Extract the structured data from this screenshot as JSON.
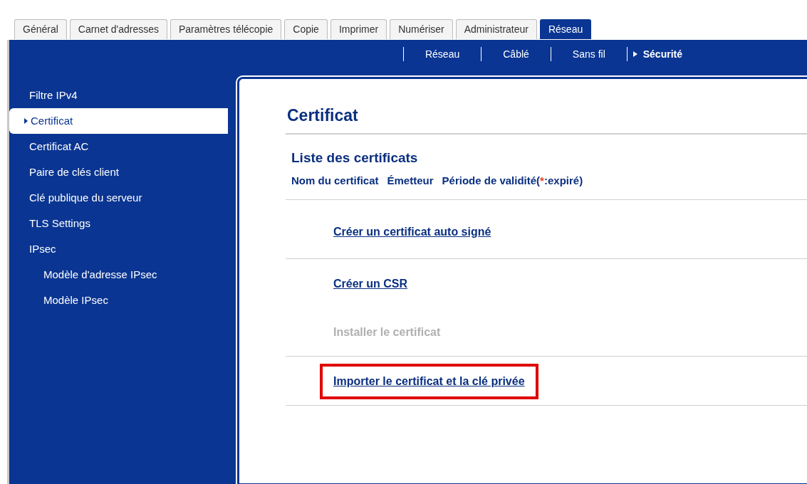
{
  "tabs": [
    {
      "label": "Général",
      "selected": false
    },
    {
      "label": "Carnet d'adresses",
      "selected": false
    },
    {
      "label": "Paramètres télécopie",
      "selected": false
    },
    {
      "label": "Copie",
      "selected": false
    },
    {
      "label": "Imprimer",
      "selected": false
    },
    {
      "label": "Numériser",
      "selected": false
    },
    {
      "label": "Administrateur",
      "selected": false
    },
    {
      "label": "Réseau",
      "selected": true
    }
  ],
  "subnav": [
    {
      "label": "Réseau",
      "selected": false
    },
    {
      "label": "Câblé",
      "selected": false
    },
    {
      "label": "Sans fil",
      "selected": false
    },
    {
      "label": "Sécurité",
      "selected": true
    }
  ],
  "sidebar": {
    "items": [
      {
        "label": "Filtre IPv4",
        "selected": false
      },
      {
        "label": "Certificat",
        "selected": true
      },
      {
        "label": "Certificat AC",
        "selected": false
      },
      {
        "label": "Paire de clés client",
        "selected": false
      },
      {
        "label": "Clé publique du serveur",
        "selected": false
      },
      {
        "label": "TLS Settings",
        "selected": false
      },
      {
        "label": "IPsec",
        "selected": false,
        "children": [
          {
            "label": "Modèle d'adresse IPsec",
            "selected": false
          },
          {
            "label": "Modèle IPsec",
            "selected": false
          }
        ]
      }
    ]
  },
  "content": {
    "title": "Certificat",
    "section_title": "Liste des certificats",
    "columns": [
      {
        "parts": [
          {
            "text": "Nom du certificat"
          }
        ]
      },
      {
        "parts": [
          {
            "text": "Émetteur"
          }
        ]
      },
      {
        "parts": [
          {
            "text": "Période de validité("
          },
          {
            "text": "*",
            "color": "#e8401c"
          },
          {
            "text": ":expiré)"
          }
        ]
      }
    ],
    "groups": [
      [
        {
          "label": "Créer un certificat auto signé",
          "disabled": false,
          "highlighted": false
        }
      ],
      [
        {
          "label": "Créer un CSR",
          "disabled": false,
          "highlighted": false
        },
        {
          "label": "Installer le certificat",
          "disabled": true,
          "highlighted": false
        }
      ],
      [
        {
          "label": "Importer le certificat et la clé privée",
          "disabled": false,
          "highlighted": true
        }
      ]
    ]
  }
}
